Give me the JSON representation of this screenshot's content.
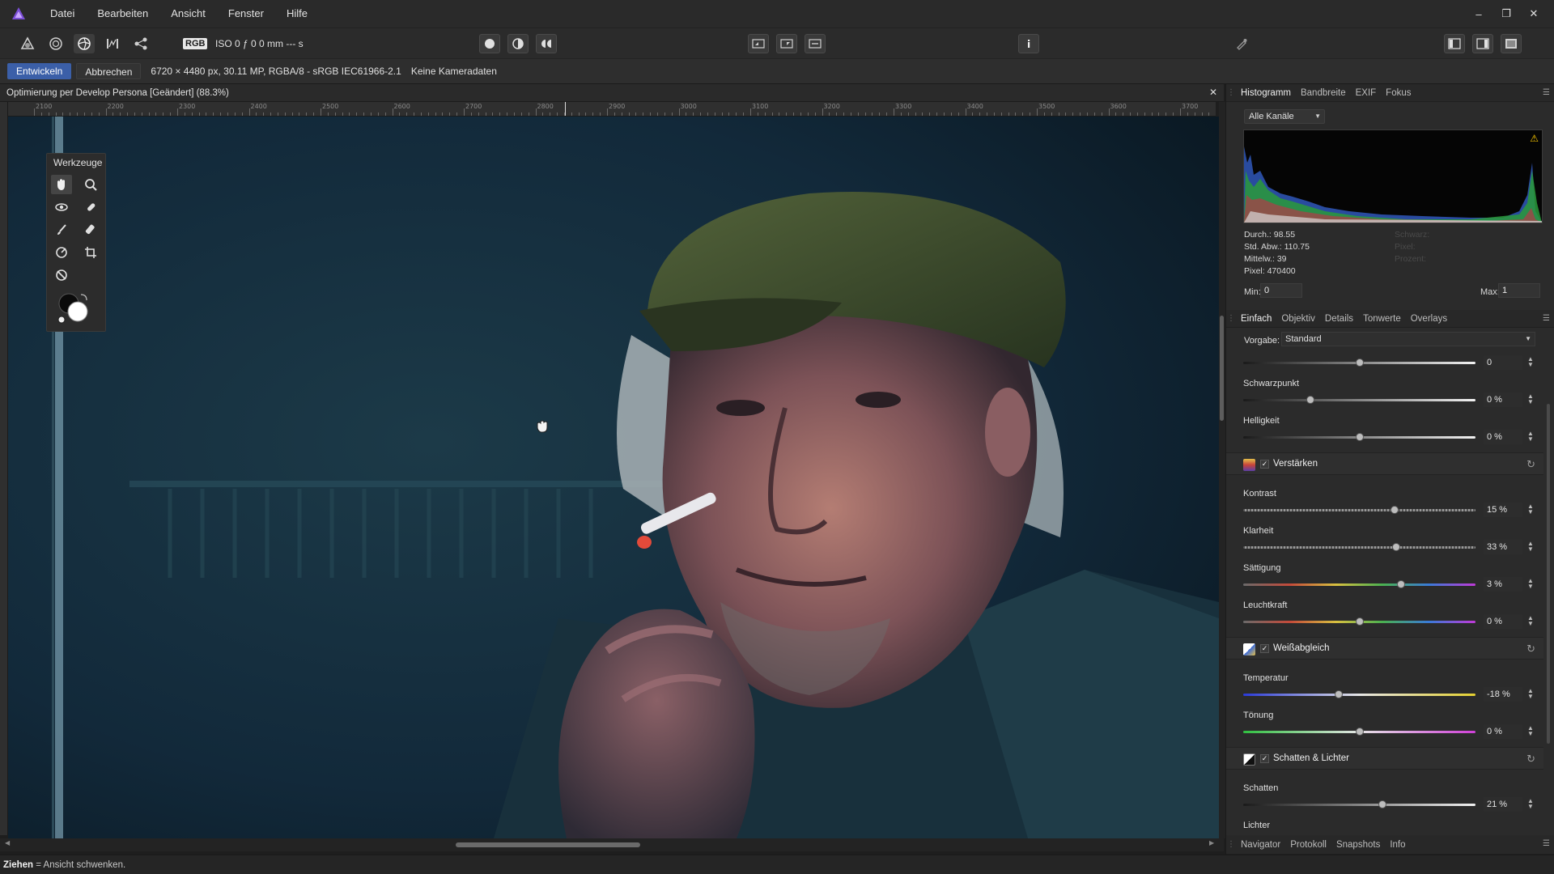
{
  "menu": {
    "items": [
      "Datei",
      "Bearbeiten",
      "Ansicht",
      "Fenster",
      "Hilfe"
    ]
  },
  "toolbar": {
    "color_badge": "RGB",
    "exif_summary": "ISO 0 ƒ 0 0 mm --- s"
  },
  "context_bar": {
    "develop_label": "Entwickeln",
    "cancel_label": "Abbrechen",
    "image_info": "6720 × 4480 px, 30.11 MP, RGBA/8 - sRGB IEC61966-2.1",
    "camera_info": "Keine Kameradaten"
  },
  "document": {
    "title": "Optimierung per Develop Persona [Geändert] (88.3%)",
    "ruler_labels": [
      "2100",
      "2200",
      "2300",
      "2400",
      "2500",
      "2600",
      "2700",
      "2800",
      "2900",
      "3000",
      "3100",
      "3200",
      "3300",
      "3400",
      "3500",
      "3600",
      "3700"
    ]
  },
  "tools_panel": {
    "title": "Werkzeuge"
  },
  "top_tabs": [
    "Histogramm",
    "Bandbreite",
    "EXIF",
    "Fokus"
  ],
  "histogram": {
    "channel": "Alle Kanäle",
    "stats": [
      "Durch.: 98.55",
      "Std. Abw.: 110.75",
      "Mittelw.: 39",
      "Pixel: 470400"
    ],
    "dim_stats": [
      "Schwarz:",
      "Pixel:",
      "Prozent:"
    ],
    "min_label": "Min:",
    "min_value": "0",
    "max_label": "Max:",
    "max_value": "1"
  },
  "adjust_tabs": [
    "Einfach",
    "Objektiv",
    "Details",
    "Tonwerte",
    "Overlays"
  ],
  "preset": {
    "label": "Vorgabe:",
    "value": "Standard"
  },
  "sliders": {
    "exposure": {
      "value": "0",
      "level": 0.5
    },
    "blackpoint": {
      "label": "Schwarzpunkt",
      "value": "0 %",
      "level": 0.29
    },
    "brightness": {
      "label": "Helligkeit",
      "value": "0 %",
      "level": 0.5
    },
    "contrast": {
      "label": "Kontrast",
      "value": "15 %",
      "level": 0.65
    },
    "clarity": {
      "label": "Klarheit",
      "value": "33 %",
      "level": 0.66
    },
    "saturation": {
      "label": "Sättigung",
      "value": "3 %",
      "level": 0.68
    },
    "vibrance": {
      "label": "Leuchtkraft",
      "value": "0 %",
      "level": 0.5
    },
    "temperature": {
      "label": "Temperatur",
      "value": "-18 %",
      "level": 0.41
    },
    "tint": {
      "label": "Tönung",
      "value": "0 %",
      "level": 0.5
    },
    "shadows": {
      "label": "Schatten",
      "value": "21 %",
      "level": 0.6
    },
    "highlights": {
      "label": "Lichter"
    }
  },
  "sections": {
    "enhance": "Verstärken",
    "white_balance": "Weißabgleich",
    "shadows_highlights": "Schatten & Lichter"
  },
  "bottom_tabs": [
    "Navigator",
    "Protokoll",
    "Snapshots",
    "Info"
  ],
  "status": {
    "key": "Ziehen",
    "text": " = Ansicht schwenken."
  },
  "colors": {
    "accent": "#3b5fa8",
    "panel": "#2b2b2b"
  }
}
